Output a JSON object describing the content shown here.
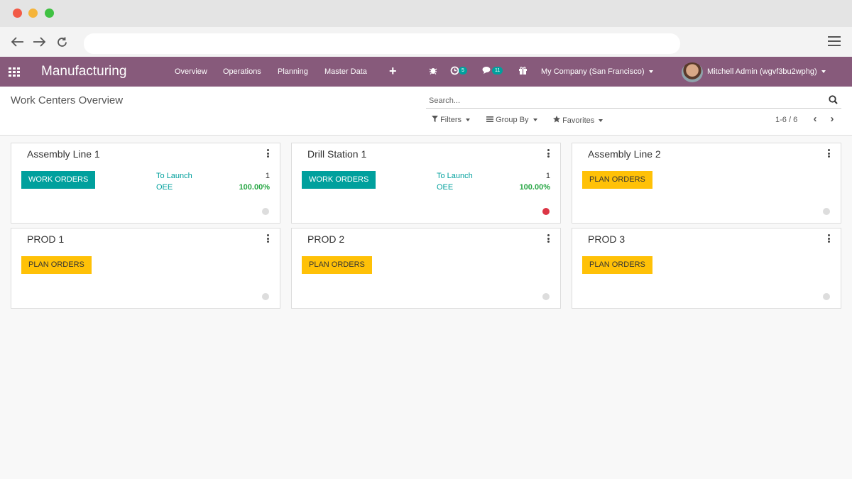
{
  "app": {
    "title": "Manufacturing",
    "menu": [
      "Overview",
      "Operations",
      "Planning",
      "Master Data"
    ],
    "add_symbol": "+",
    "activity_badge": "5",
    "messages_badge": "11",
    "company": "My Company (San Francisco)",
    "user": "Mitchell Admin (wgvf3bu2wphg)"
  },
  "control": {
    "breadcrumb": "Work Centers Overview",
    "search_placeholder": "Search...",
    "filters_label": "Filters",
    "groupby_label": "Group By",
    "favorites_label": "Favorites",
    "pager": "1-6 / 6"
  },
  "cards": [
    {
      "name": "Assembly Line 1",
      "button": "WORK ORDERS",
      "to_launch_label": "To Launch",
      "to_launch": "1",
      "oee_label": "OEE",
      "oee": "100.00%",
      "status": "normal"
    },
    {
      "name": "Drill Station 1",
      "button": "WORK ORDERS",
      "to_launch_label": "To Launch",
      "to_launch": "1",
      "oee_label": "OEE",
      "oee": "100.00%",
      "status": "blocked"
    },
    {
      "name": "Assembly Line 2",
      "button": "PLAN ORDERS",
      "status": "normal"
    },
    {
      "name": "PROD 1",
      "button": "PLAN ORDERS",
      "status": "normal"
    },
    {
      "name": "PROD 2",
      "button": "PLAN ORDERS",
      "status": "normal"
    },
    {
      "name": "PROD 3",
      "button": "PLAN ORDERS",
      "status": "normal"
    }
  ],
  "colors": {
    "brand": "#875a7b",
    "teal": "#00a09d",
    "yellow": "#ffc107",
    "oee_green": "#28a745",
    "blocked_red": "#dc3545"
  }
}
